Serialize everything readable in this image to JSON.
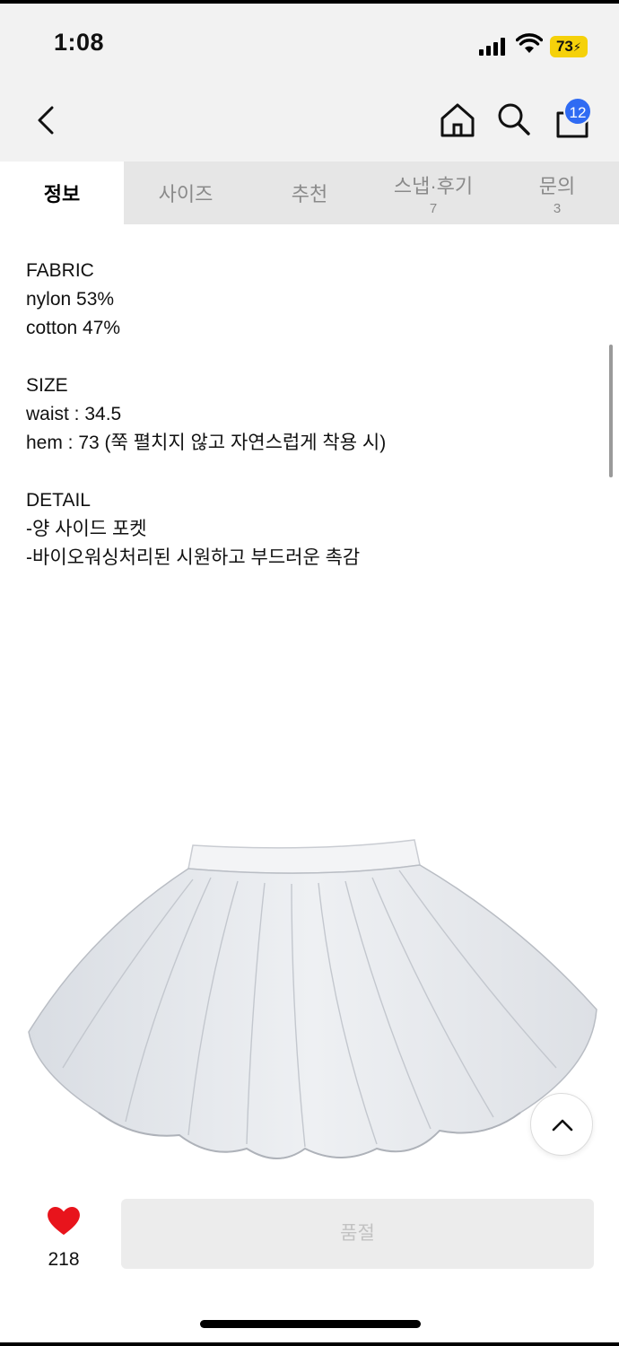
{
  "status_bar": {
    "time": "1:08",
    "battery": "73",
    "icons": [
      "cellular-signal-icon",
      "wifi-icon",
      "battery-charging-icon"
    ]
  },
  "nav": {
    "icons": [
      "chevron-left-icon",
      "home-icon",
      "search-icon",
      "shopping-bag-icon"
    ],
    "cart_count": "12"
  },
  "tabs": [
    {
      "label": "정보",
      "count": ""
    },
    {
      "label": "사이즈",
      "count": ""
    },
    {
      "label": "추천",
      "count": ""
    },
    {
      "label": "스냅·후기",
      "count": "7"
    },
    {
      "label": "문의",
      "count": "3"
    }
  ],
  "content": {
    "fabric": {
      "title": "FABRIC",
      "lines": [
        "nylon 53%",
        "cotton 47%"
      ]
    },
    "size": {
      "title": "SIZE",
      "lines": [
        "waist : 34.5",
        "hem : 73 (쭉 펼치지 않고 자연스럽게 착용 시)"
      ]
    },
    "detail": {
      "title": "DETAIL",
      "lines": [
        "-양 사이드 포켓",
        "-바이오워싱처리된 시원하고 부드러운 촉감"
      ]
    }
  },
  "bottom_bar": {
    "like_count": "218",
    "soldout_label": "품절"
  },
  "colors": {
    "badge": "#2f6bf3",
    "heart": "#e8141c",
    "battery": "#f5d10a"
  }
}
